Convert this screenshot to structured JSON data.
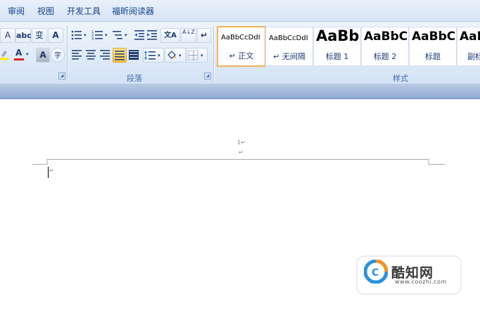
{
  "menu": [
    "审阅",
    "视图",
    "开发工具",
    "福昕阅读器"
  ],
  "font_group": {
    "row1": [
      "A",
      "ᴬ",
      "abc",
      "变",
      "A"
    ],
    "row2": [
      "A",
      "A",
      "字"
    ]
  },
  "paragraph_group": {
    "label": "段落",
    "row1": [
      "☰",
      "☰",
      "☰",
      "⇤",
      "⇥",
      "文A",
      "A↓Z",
      "↵"
    ],
    "row2": [
      "≡",
      "≡",
      "≡",
      "≡",
      "▦",
      "↕≡",
      "◈",
      "⊞"
    ]
  },
  "styles_group": {
    "label": "样式",
    "tiles": [
      {
        "sample": "AaBbCcDdI",
        "name": "↵ 正文"
      },
      {
        "sample": "AaBbCcDdI",
        "name": "↵ 无间隔"
      },
      {
        "sample": "AaBb",
        "name": "标题 1"
      },
      {
        "sample": "AaBbC",
        "name": "标题 2"
      },
      {
        "sample": "AaBbC",
        "name": "标题"
      },
      {
        "sample": "AaE",
        "name": "副标"
      }
    ]
  },
  "document": {
    "page_number": "1↵",
    "paragraph_mark": "↵",
    "cursor_mark": "↵"
  },
  "watermark": {
    "brand": "酷知网",
    "url": "www.coozhi.com"
  },
  "colors": {
    "menu_text": "#15428b",
    "ribbon_label": "#3e6aaa",
    "selected_style_border": "#f0b45b",
    "font_color_red": "#e02020",
    "highlight_yellow": "#ffe600"
  }
}
